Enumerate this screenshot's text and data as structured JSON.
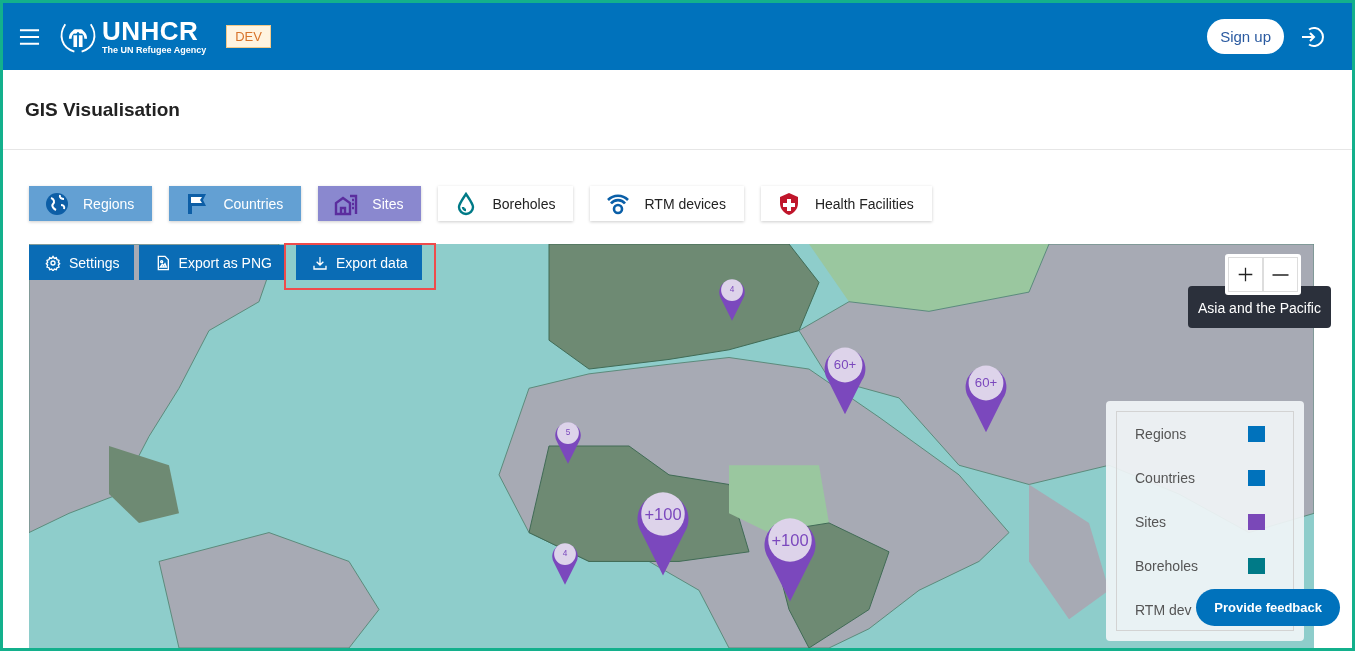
{
  "header": {
    "logo_name": "UNHCR",
    "logo_tagline": "The UN Refugee Agency",
    "env_badge": "DEV",
    "sign_up": "Sign up"
  },
  "page": {
    "title": "GIS Visualisation"
  },
  "layers": [
    {
      "label": "Regions",
      "kind": "globe",
      "selected": true,
      "color": "#0d5ea6"
    },
    {
      "label": "Countries",
      "kind": "flag",
      "selected": true,
      "color": "#0d5ea6"
    },
    {
      "label": "Sites",
      "kind": "building",
      "selected": true,
      "color": "#5b2d9e"
    },
    {
      "label": "Boreholes",
      "kind": "drop",
      "selected": false,
      "color": "#007a87"
    },
    {
      "label": "RTM devices",
      "kind": "signal",
      "selected": false,
      "color": "#0a5fa8"
    },
    {
      "label": "Health Facilities",
      "kind": "shield",
      "selected": false,
      "color": "#c0162b"
    }
  ],
  "map": {
    "toolbar": [
      {
        "label": "Settings",
        "kind": "settings",
        "highlighted": false
      },
      {
        "label": "Export as PNG",
        "kind": "image",
        "highlighted": false
      },
      {
        "label": "Export data",
        "kind": "download",
        "highlighted": true
      }
    ],
    "tooltip": "Asia and the Pacific",
    "pins": [
      {
        "label": "4"
      },
      {
        "label": "60+"
      },
      {
        "label": "60+"
      },
      {
        "label": "5"
      },
      {
        "label": "+100"
      },
      {
        "label": "+100"
      },
      {
        "label": "4"
      }
    ],
    "legend": [
      {
        "label": "Regions",
        "color": "#0072bc"
      },
      {
        "label": "Countries",
        "color": "#0072bc"
      },
      {
        "label": "Sites",
        "color": "#7a48b8"
      },
      {
        "label": "Boreholes",
        "color": "#007a87"
      },
      {
        "label": "RTM dev"
      }
    ]
  },
  "feedback_button": "Provide feedback"
}
